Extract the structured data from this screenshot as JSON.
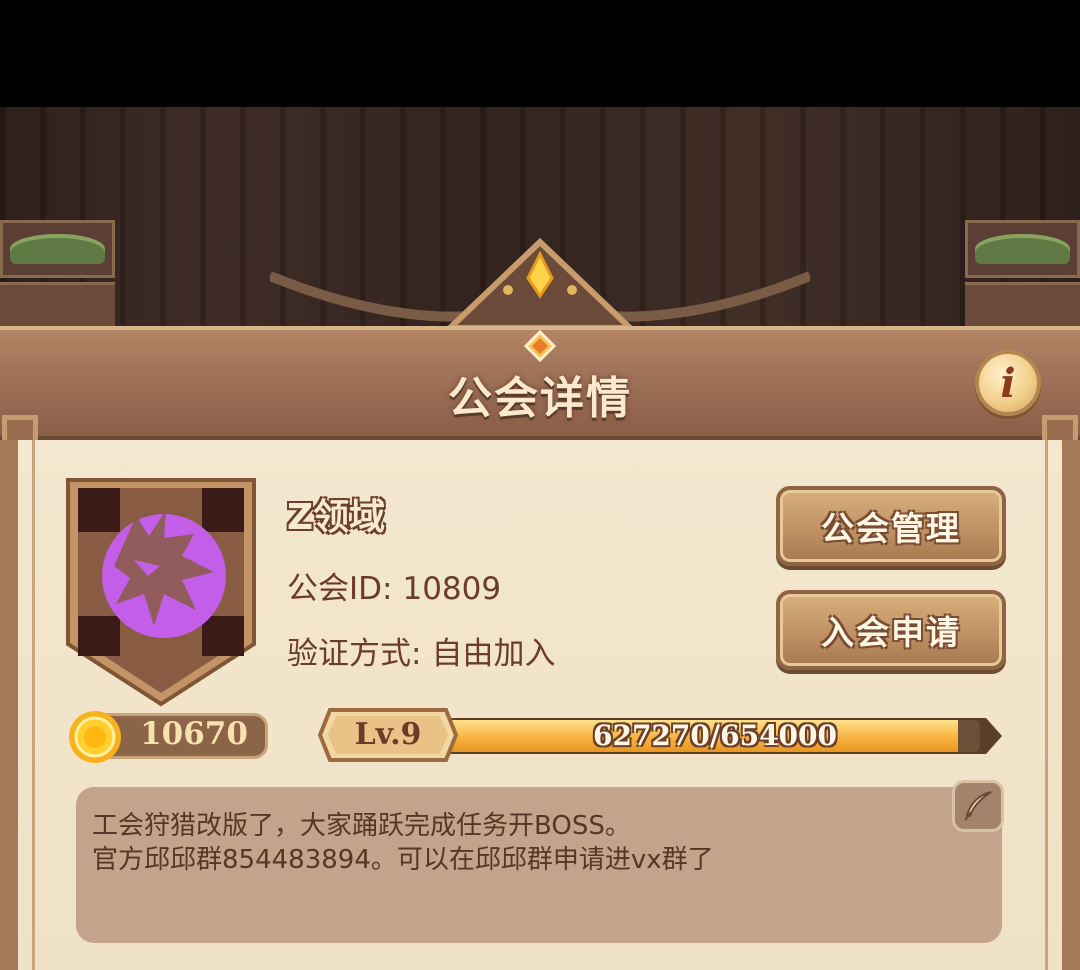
{
  "header": {
    "title": "公会详情"
  },
  "guild": {
    "name": "Z领域",
    "id_label": "公会ID:",
    "id_value": "10809",
    "verify_label": "验证方式:",
    "verify_value": "自由加入",
    "emblem_icon": "wolf-shield-icon",
    "emblem_color": "#c35ee8"
  },
  "actions": {
    "manage_label": "公会管理",
    "apply_label": "入会申请"
  },
  "funds": {
    "icon": "sun-coin-icon",
    "value": "10670"
  },
  "level": {
    "label": "Lv.9",
    "xp_text": "627270/654000",
    "xp_current": 627270,
    "xp_max": 654000
  },
  "notice": {
    "lines": [
      "工会狩猎改版了，大家踊跃完成任务开BOSS。",
      "官方邱邱群854483894。可以在邱邱群申请进vx群了"
    ],
    "edit_icon": "quill-icon"
  },
  "info_icon": "info-icon"
}
